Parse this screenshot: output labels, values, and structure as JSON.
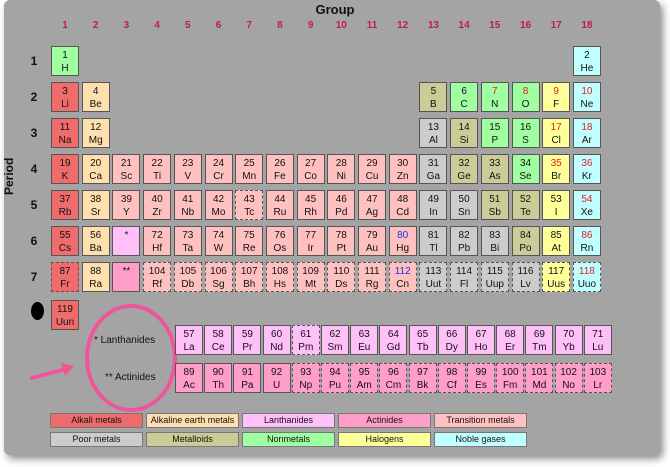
{
  "titles": {
    "group": "Group",
    "period": "Period"
  },
  "groups": [
    "1",
    "2",
    "3",
    "4",
    "5",
    "6",
    "7",
    "8",
    "9",
    "10",
    "11",
    "12",
    "13",
    "14",
    "15",
    "16",
    "17",
    "18"
  ],
  "periods": [
    "1",
    "2",
    "3",
    "4",
    "5",
    "6",
    "7"
  ],
  "elements": [
    {
      "n": "1",
      "s": "H",
      "c": "nonmetal",
      "col": 1,
      "row": 1
    },
    {
      "n": "2",
      "s": "He",
      "c": "noble",
      "col": 18,
      "row": 1
    },
    {
      "n": "3",
      "s": "Li",
      "c": "alkali",
      "col": 1,
      "row": 2
    },
    {
      "n": "4",
      "s": "Be",
      "c": "alkaline",
      "col": 2,
      "row": 2
    },
    {
      "n": "5",
      "s": "B",
      "c": "metalloid",
      "col": 13,
      "row": 2
    },
    {
      "n": "6",
      "s": "C",
      "c": "nonmetal",
      "col": 14,
      "row": 2
    },
    {
      "n": "7",
      "s": "N",
      "c": "nonmetal",
      "col": 15,
      "row": 2,
      "nc": "red"
    },
    {
      "n": "8",
      "s": "O",
      "c": "nonmetal",
      "col": 16,
      "row": 2,
      "nc": "red"
    },
    {
      "n": "9",
      "s": "F",
      "c": "halogen",
      "col": 17,
      "row": 2,
      "nc": "red"
    },
    {
      "n": "10",
      "s": "Ne",
      "c": "noble",
      "col": 18,
      "row": 2,
      "nc": "red"
    },
    {
      "n": "11",
      "s": "Na",
      "c": "alkali",
      "col": 1,
      "row": 3
    },
    {
      "n": "12",
      "s": "Mg",
      "c": "alkaline",
      "col": 2,
      "row": 3
    },
    {
      "n": "13",
      "s": "Al",
      "c": "poor",
      "col": 13,
      "row": 3
    },
    {
      "n": "14",
      "s": "Si",
      "c": "metalloid",
      "col": 14,
      "row": 3
    },
    {
      "n": "15",
      "s": "P",
      "c": "nonmetal",
      "col": 15,
      "row": 3
    },
    {
      "n": "16",
      "s": "S",
      "c": "nonmetal",
      "col": 16,
      "row": 3
    },
    {
      "n": "17",
      "s": "Cl",
      "c": "halogen",
      "col": 17,
      "row": 3,
      "nc": "red"
    },
    {
      "n": "18",
      "s": "Ar",
      "c": "noble",
      "col": 18,
      "row": 3,
      "nc": "red"
    },
    {
      "n": "19",
      "s": "K",
      "c": "alkali",
      "col": 1,
      "row": 4
    },
    {
      "n": "20",
      "s": "Ca",
      "c": "alkaline",
      "col": 2,
      "row": 4
    },
    {
      "n": "21",
      "s": "Sc",
      "c": "trans",
      "col": 3,
      "row": 4
    },
    {
      "n": "22",
      "s": "Ti",
      "c": "trans",
      "col": 4,
      "row": 4
    },
    {
      "n": "23",
      "s": "V",
      "c": "trans",
      "col": 5,
      "row": 4
    },
    {
      "n": "24",
      "s": "Cr",
      "c": "trans",
      "col": 6,
      "row": 4
    },
    {
      "n": "25",
      "s": "Mn",
      "c": "trans",
      "col": 7,
      "row": 4
    },
    {
      "n": "26",
      "s": "Fe",
      "c": "trans",
      "col": 8,
      "row": 4
    },
    {
      "n": "27",
      "s": "Co",
      "c": "trans",
      "col": 9,
      "row": 4
    },
    {
      "n": "28",
      "s": "Ni",
      "c": "trans",
      "col": 10,
      "row": 4
    },
    {
      "n": "29",
      "s": "Cu",
      "c": "trans",
      "col": 11,
      "row": 4
    },
    {
      "n": "30",
      "s": "Zn",
      "c": "trans",
      "col": 12,
      "row": 4
    },
    {
      "n": "31",
      "s": "Ga",
      "c": "poor",
      "col": 13,
      "row": 4
    },
    {
      "n": "32",
      "s": "Ge",
      "c": "metalloid",
      "col": 14,
      "row": 4
    },
    {
      "n": "33",
      "s": "As",
      "c": "metalloid",
      "col": 15,
      "row": 4
    },
    {
      "n": "34",
      "s": "Se",
      "c": "nonmetal",
      "col": 16,
      "row": 4
    },
    {
      "n": "35",
      "s": "Br",
      "c": "halogen",
      "col": 17,
      "row": 4,
      "nc": "red"
    },
    {
      "n": "36",
      "s": "Kr",
      "c": "noble",
      "col": 18,
      "row": 4,
      "nc": "red"
    },
    {
      "n": "37",
      "s": "Rb",
      "c": "alkali",
      "col": 1,
      "row": 5
    },
    {
      "n": "38",
      "s": "Sr",
      "c": "alkaline",
      "col": 2,
      "row": 5
    },
    {
      "n": "39",
      "s": "Y",
      "c": "trans",
      "col": 3,
      "row": 5
    },
    {
      "n": "40",
      "s": "Zr",
      "c": "trans",
      "col": 4,
      "row": 5
    },
    {
      "n": "41",
      "s": "Nb",
      "c": "trans",
      "col": 5,
      "row": 5
    },
    {
      "n": "42",
      "s": "Mo",
      "c": "trans",
      "col": 6,
      "row": 5
    },
    {
      "n": "43",
      "s": "Tc",
      "c": "trans",
      "col": 7,
      "row": 5,
      "d": true
    },
    {
      "n": "44",
      "s": "Ru",
      "c": "trans",
      "col": 8,
      "row": 5
    },
    {
      "n": "45",
      "s": "Rh",
      "c": "trans",
      "col": 9,
      "row": 5
    },
    {
      "n": "46",
      "s": "Pd",
      "c": "trans",
      "col": 10,
      "row": 5
    },
    {
      "n": "47",
      "s": "Ag",
      "c": "trans",
      "col": 11,
      "row": 5
    },
    {
      "n": "48",
      "s": "Cd",
      "c": "trans",
      "col": 12,
      "row": 5
    },
    {
      "n": "49",
      "s": "In",
      "c": "poor",
      "col": 13,
      "row": 5
    },
    {
      "n": "50",
      "s": "Sn",
      "c": "poor",
      "col": 14,
      "row": 5
    },
    {
      "n": "51",
      "s": "Sb",
      "c": "metalloid",
      "col": 15,
      "row": 5
    },
    {
      "n": "52",
      "s": "Te",
      "c": "metalloid",
      "col": 16,
      "row": 5
    },
    {
      "n": "53",
      "s": "I",
      "c": "halogen",
      "col": 17,
      "row": 5
    },
    {
      "n": "54",
      "s": "Xe",
      "c": "noble",
      "col": 18,
      "row": 5,
      "nc": "red"
    },
    {
      "n": "55",
      "s": "Cs",
      "c": "alkali",
      "col": 1,
      "row": 6
    },
    {
      "n": "56",
      "s": "Ba",
      "c": "alkaline",
      "col": 2,
      "row": 6
    },
    {
      "n": "",
      "s": "*",
      "c": "lanth",
      "col": 3,
      "row": 6
    },
    {
      "n": "72",
      "s": "Hf",
      "c": "trans",
      "col": 4,
      "row": 6
    },
    {
      "n": "73",
      "s": "Ta",
      "c": "trans",
      "col": 5,
      "row": 6
    },
    {
      "n": "74",
      "s": "W",
      "c": "trans",
      "col": 6,
      "row": 6
    },
    {
      "n": "75",
      "s": "Re",
      "c": "trans",
      "col": 7,
      "row": 6
    },
    {
      "n": "76",
      "s": "Os",
      "c": "trans",
      "col": 8,
      "row": 6
    },
    {
      "n": "77",
      "s": "Ir",
      "c": "trans",
      "col": 9,
      "row": 6
    },
    {
      "n": "78",
      "s": "Pt",
      "c": "trans",
      "col": 10,
      "row": 6
    },
    {
      "n": "79",
      "s": "Au",
      "c": "trans",
      "col": 11,
      "row": 6
    },
    {
      "n": "80",
      "s": "Hg",
      "c": "trans",
      "col": 12,
      "row": 6,
      "nc": "blue"
    },
    {
      "n": "81",
      "s": "Tl",
      "c": "poor",
      "col": 13,
      "row": 6
    },
    {
      "n": "82",
      "s": "Pb",
      "c": "poor",
      "col": 14,
      "row": 6
    },
    {
      "n": "83",
      "s": "Bi",
      "c": "poor",
      "col": 15,
      "row": 6
    },
    {
      "n": "84",
      "s": "Po",
      "c": "metalloid",
      "col": 16,
      "row": 6
    },
    {
      "n": "85",
      "s": "At",
      "c": "halogen",
      "col": 17,
      "row": 6
    },
    {
      "n": "86",
      "s": "Rn",
      "c": "noble",
      "col": 18,
      "row": 6,
      "nc": "red"
    },
    {
      "n": "87",
      "s": "Fr",
      "c": "alkali",
      "col": 1,
      "row": 7,
      "d": true
    },
    {
      "n": "88",
      "s": "Ra",
      "c": "alkaline",
      "col": 2,
      "row": 7
    },
    {
      "n": "",
      "s": "**",
      "c": "actin",
      "col": 3,
      "row": 7
    },
    {
      "n": "104",
      "s": "Rf",
      "c": "trans",
      "col": 4,
      "row": 7,
      "d": true
    },
    {
      "n": "105",
      "s": "Db",
      "c": "trans",
      "col": 5,
      "row": 7,
      "d": true
    },
    {
      "n": "106",
      "s": "Sg",
      "c": "trans",
      "col": 6,
      "row": 7,
      "d": true
    },
    {
      "n": "107",
      "s": "Bh",
      "c": "trans",
      "col": 7,
      "row": 7,
      "d": true
    },
    {
      "n": "108",
      "s": "Hs",
      "c": "trans",
      "col": 8,
      "row": 7,
      "d": true
    },
    {
      "n": "109",
      "s": "Mt",
      "c": "trans",
      "col": 9,
      "row": 7,
      "d": true
    },
    {
      "n": "110",
      "s": "Ds",
      "c": "trans",
      "col": 10,
      "row": 7,
      "d": true
    },
    {
      "n": "111",
      "s": "Rg",
      "c": "trans",
      "col": 11,
      "row": 7,
      "d": true
    },
    {
      "n": "112",
      "s": "Cn",
      "c": "trans",
      "col": 12,
      "row": 7,
      "d": true,
      "nc": "blue"
    },
    {
      "n": "113",
      "s": "Uut",
      "c": "poor",
      "col": 13,
      "row": 7,
      "d": true
    },
    {
      "n": "114",
      "s": "Fl",
      "c": "poor",
      "col": 14,
      "row": 7,
      "d": true
    },
    {
      "n": "115",
      "s": "Uup",
      "c": "poor",
      "col": 15,
      "row": 7,
      "d": true
    },
    {
      "n": "116",
      "s": "Lv",
      "c": "poor",
      "col": 16,
      "row": 7,
      "d": true
    },
    {
      "n": "117",
      "s": "Uus",
      "c": "halogen",
      "col": 17,
      "row": 7,
      "d": true
    },
    {
      "n": "118",
      "s": "Uuo",
      "c": "noble",
      "col": 18,
      "row": 7,
      "d": true,
      "nc": "red"
    }
  ],
  "extra_element": {
    "n": "119",
    "s": "Uun",
    "c": "alkali"
  },
  "lanthanides": [
    {
      "n": "57",
      "s": "La"
    },
    {
      "n": "58",
      "s": "Ce"
    },
    {
      "n": "59",
      "s": "Pr"
    },
    {
      "n": "60",
      "s": "Nd"
    },
    {
      "n": "61",
      "s": "Pm",
      "d": true
    },
    {
      "n": "62",
      "s": "Sm"
    },
    {
      "n": "63",
      "s": "Eu"
    },
    {
      "n": "64",
      "s": "Gd"
    },
    {
      "n": "65",
      "s": "Tb"
    },
    {
      "n": "66",
      "s": "Dy"
    },
    {
      "n": "67",
      "s": "Ho"
    },
    {
      "n": "68",
      "s": "Er"
    },
    {
      "n": "69",
      "s": "Tm"
    },
    {
      "n": "70",
      "s": "Yb"
    },
    {
      "n": "71",
      "s": "Lu"
    }
  ],
  "actinides": [
    {
      "n": "89",
      "s": "Ac"
    },
    {
      "n": "90",
      "s": "Th"
    },
    {
      "n": "91",
      "s": "Pa"
    },
    {
      "n": "92",
      "s": "U"
    },
    {
      "n": "93",
      "s": "Np",
      "d": true
    },
    {
      "n": "94",
      "s": "Pu",
      "d": true
    },
    {
      "n": "95",
      "s": "Am",
      "d": true
    },
    {
      "n": "96",
      "s": "Cm",
      "d": true
    },
    {
      "n": "97",
      "s": "Bk",
      "d": true
    },
    {
      "n": "98",
      "s": "Cf",
      "d": true
    },
    {
      "n": "99",
      "s": "Es",
      "d": true
    },
    {
      "n": "100",
      "s": "Fm",
      "d": true
    },
    {
      "n": "101",
      "s": "Md",
      "d": true
    },
    {
      "n": "102",
      "s": "No",
      "d": true
    },
    {
      "n": "103",
      "s": "Lr",
      "d": true
    }
  ],
  "series_labels": {
    "lanthanides": "* Lanthanides",
    "actinides": "** Actinides"
  },
  "legend": [
    {
      "label": "Alkali metals",
      "c": "alkali"
    },
    {
      "label": "Alkaline earth metals",
      "c": "alkaline"
    },
    {
      "label": "Lanthanides",
      "c": "lanth"
    },
    {
      "label": "Actinides",
      "c": "actin"
    },
    {
      "label": "Transition metals",
      "c": "trans"
    },
    {
      "label": "Poor metals",
      "c": "poor"
    },
    {
      "label": "Metalloids",
      "c": "metalloid"
    },
    {
      "label": "Nonmetals",
      "c": "nonmetal"
    },
    {
      "label": "Halogens",
      "c": "halogen"
    },
    {
      "label": "Noble gases",
      "c": "noble"
    }
  ],
  "colors": {
    "alkali": "#f06b6b",
    "alkaline": "#ffdfae",
    "lanth": "#ffbff8",
    "actin": "#ff9ec9",
    "trans": "#ffc0c0",
    "poor": "#cccccc",
    "metalloid": "#cccc99",
    "nonmetal": "#a0ffa0",
    "halogen": "#ffff99",
    "noble": "#c0ffff",
    "highlight": "#f0549a"
  }
}
